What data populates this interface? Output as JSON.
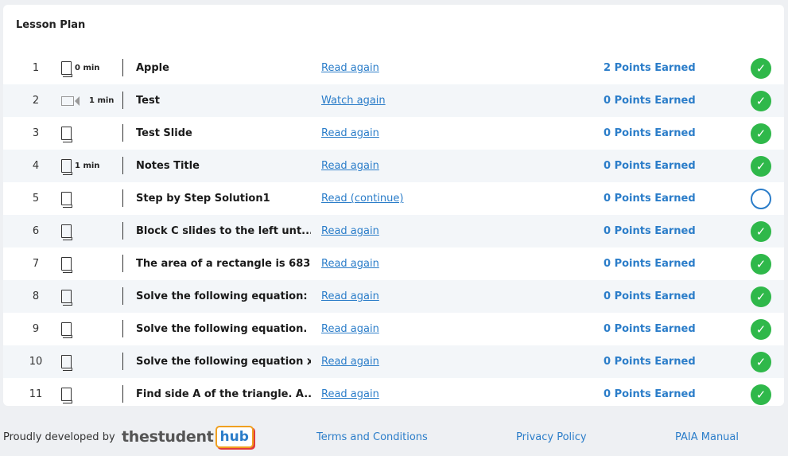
{
  "lesson_plan": {
    "title": "Lesson Plan",
    "rows": [
      {
        "num": "1",
        "type": "book",
        "duration": "0 min",
        "title": "Apple",
        "action": "Read again",
        "points": "2 Points Earned",
        "complete": true
      },
      {
        "num": "2",
        "type": "video",
        "duration": "1 min",
        "title": "Test",
        "action": "Watch again",
        "points": "0 Points Earned",
        "complete": true
      },
      {
        "num": "3",
        "type": "book",
        "duration": "",
        "title": "Test Slide",
        "action": "Read again",
        "points": "0 Points Earned",
        "complete": true
      },
      {
        "num": "4",
        "type": "book",
        "duration": "1 min",
        "title": "Notes Title",
        "action": "Read again",
        "points": "0 Points Earned",
        "complete": true
      },
      {
        "num": "5",
        "type": "book",
        "duration": "",
        "title": "Step by Step Solution1",
        "action": "Read (continue)",
        "points": "0 Points Earned",
        "complete": false
      },
      {
        "num": "6",
        "type": "book",
        "duration": "",
        "title": "Block C slides to the left unt...",
        "action": "Read again",
        "points": "0 Points Earned",
        "complete": true
      },
      {
        "num": "7",
        "type": "book",
        "duration": "",
        "title": "The area of a rectangle is 683...",
        "action": "Read again",
        "points": "0 Points Earned",
        "complete": true
      },
      {
        "num": "8",
        "type": "book",
        "duration": "",
        "title": "Solve the following equation: ...",
        "action": "Read again",
        "points": "0 Points Earned",
        "complete": true
      },
      {
        "num": "9",
        "type": "book",
        "duration": "",
        "title": "Solve the following equation. ...",
        "action": "Read again",
        "points": "0 Points Earned",
        "complete": true
      },
      {
        "num": "10",
        "type": "book",
        "duration": "",
        "title": "Solve the following equation x...",
        "action": "Read again",
        "points": "0 Points Earned",
        "complete": true
      },
      {
        "num": "11",
        "type": "book",
        "duration": "",
        "title": "Find side A of the triangle. A...",
        "action": "Read again",
        "points": "0 Points Earned",
        "complete": true
      }
    ]
  },
  "footer": {
    "developed_by": "Proudly developed by",
    "logo_main": "thestudent",
    "logo_hub": "hub",
    "terms": "Terms and Conditions",
    "privacy": "Privacy Policy",
    "paia": "PAIA Manual"
  },
  "colors": {
    "link": "#2b7dc9",
    "complete": "#2fb84a",
    "row_alt": "#f3f6f9"
  }
}
